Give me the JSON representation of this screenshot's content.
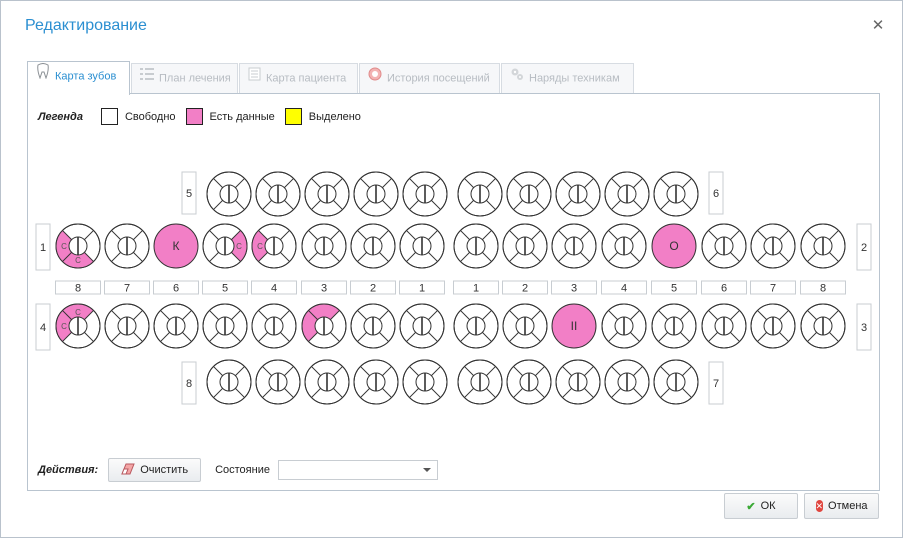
{
  "dialog": {
    "title": "Редактирование"
  },
  "tabs": [
    {
      "label": "Карта зубов",
      "icon": "tooth-icon",
      "active": true
    },
    {
      "label": "План лечения",
      "icon": "list-icon",
      "active": false
    },
    {
      "label": "Карта пациента",
      "icon": "card-icon",
      "active": false
    },
    {
      "label": "История посещений",
      "icon": "history-icon",
      "active": false
    },
    {
      "label": "Наряды техникам",
      "icon": "gears-icon",
      "active": false
    }
  ],
  "legend": {
    "title": "Легенда",
    "items": [
      {
        "label": "Свободно",
        "color": "#ffffff"
      },
      {
        "label": "Есть данные",
        "color": "#f27fc6"
      },
      {
        "label": "Выделено",
        "color": "#ffff00"
      }
    ]
  },
  "dental_chart": {
    "data_color": "#f27fc6",
    "quadrant_labels": {
      "upper_left_child": "5",
      "upper_right_child": "6",
      "upper_left": "1",
      "upper_right": "2",
      "lower_left": "4",
      "lower_right": "3",
      "lower_left_child": "8",
      "lower_right_child": "7"
    },
    "number_row": [
      "8",
      "7",
      "6",
      "5",
      "4",
      "3",
      "2",
      "1",
      "1",
      "2",
      "3",
      "4",
      "5",
      "6",
      "7",
      "8"
    ],
    "row_top_child": [
      {},
      {},
      {},
      {},
      {},
      {},
      {},
      {},
      {},
      {}
    ],
    "row_upper": [
      {
        "segments": {
          "left": "С",
          "bottom": "С"
        }
      },
      {},
      {
        "full": "К"
      },
      {
        "segments": {
          "right": "С"
        }
      },
      {
        "segments": {
          "left": "С"
        }
      },
      {},
      {},
      {},
      {},
      {},
      {},
      {},
      {
        "full": "О"
      },
      {},
      {},
      {}
    ],
    "row_lower": [
      {
        "segments": {
          "top": "С",
          "left": "С"
        }
      },
      {},
      {},
      {},
      {},
      {
        "segments": {
          "top": "",
          "left": ""
        }
      },
      {},
      {},
      {},
      {},
      {
        "full": "II"
      },
      {},
      {},
      {},
      {},
      {}
    ],
    "row_bottom_child": [
      {},
      {},
      {},
      {},
      {},
      {},
      {},
      {},
      {},
      {}
    ]
  },
  "actions": {
    "title": "Действия:",
    "clear_label": "Очистить",
    "state_label": "Состояние",
    "state_value": ""
  },
  "footer": {
    "ok_label": "ОК",
    "cancel_label": "Отмена"
  }
}
